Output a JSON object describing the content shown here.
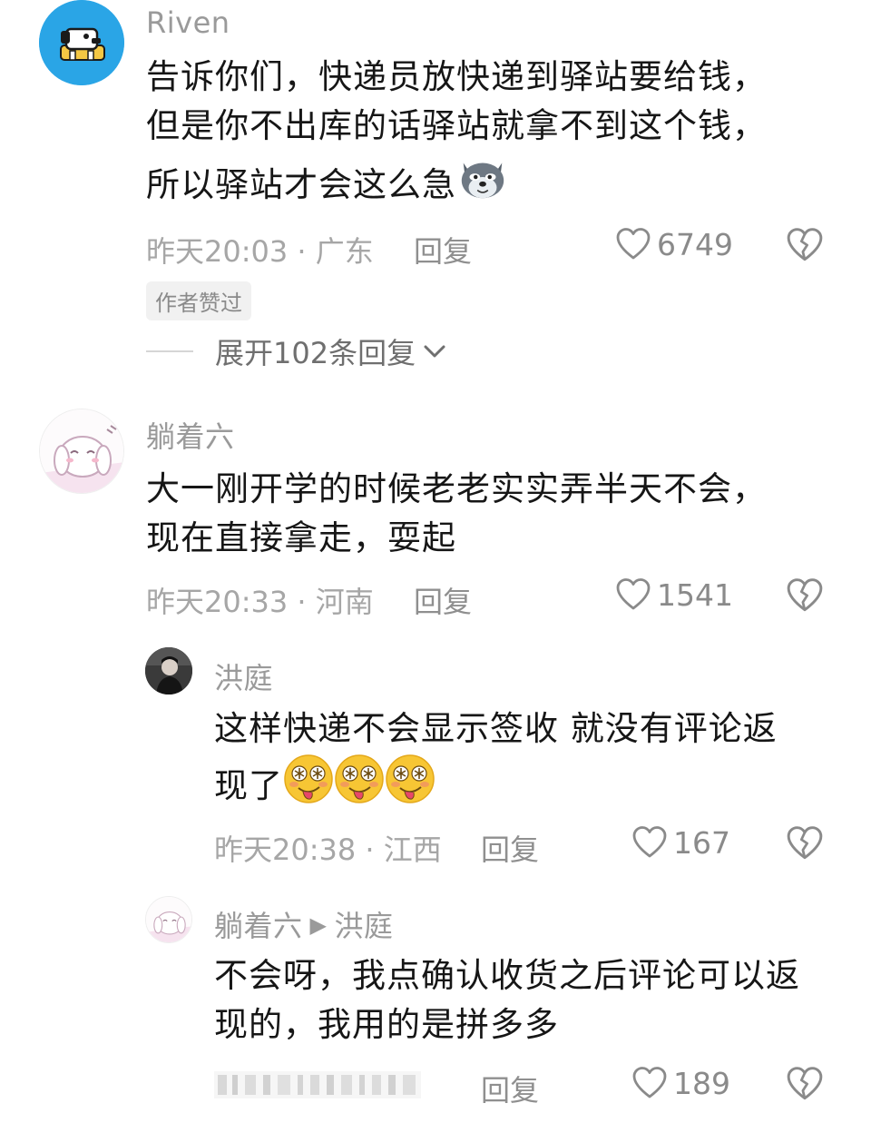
{
  "colors": {
    "text_primary": "#161616",
    "text_secondary": "#9a9a9a",
    "badge_bg": "#f1f1f1"
  },
  "comments": [
    {
      "username": "Riven",
      "lines": [
        "告诉你们，快递员放快递到驿站要给钱，",
        "但是你不出库的话驿站就拿不到这个钱，",
        "所以驿站才会这么急"
      ],
      "meta": "昨天20:03 · 广东",
      "reply_label": "回复",
      "likes": "6749",
      "badge": "作者赞过",
      "expand_label": "展开102条回复"
    },
    {
      "username": "躺着六",
      "lines": [
        "大一刚开学的时候老老实实弄半天不会，",
        "现在直接拿走，耍起"
      ],
      "meta": "昨天20:33 · 河南",
      "reply_label": "回复",
      "likes": "1541"
    }
  ],
  "replies": [
    {
      "username": "洪庭",
      "lines": [
        "这样快递不会显示签收 就没有评论返",
        "现了"
      ],
      "meta": "昨天20:38 · 江西",
      "reply_label": "回复",
      "likes": "167"
    },
    {
      "username": "躺着六",
      "reply_to": "洪庭",
      "lines": [
        "不会呀，我点确认收货之后评论可以返",
        "现的，我用的是拼多多"
      ],
      "reply_label": "回复",
      "likes": "189"
    }
  ],
  "icons": {
    "like": "heart-outline-icon",
    "dislike": "broken-heart-icon",
    "expand": "chevron-down-icon"
  }
}
